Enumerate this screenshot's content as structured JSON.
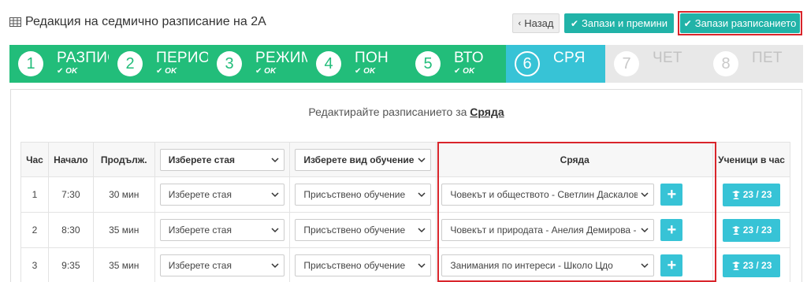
{
  "header": {
    "title": "Редакция на седмично разписание на 2А",
    "back_label": "Назад",
    "save_next_label": "Запази и премини",
    "save_label": "Запази разписанието"
  },
  "wizard": {
    "steps": [
      {
        "number": "1",
        "label": "РАЗПИС",
        "status": "OK",
        "state": "done"
      },
      {
        "number": "2",
        "label": "ПЕРИО,",
        "status": "OK",
        "state": "done"
      },
      {
        "number": "3",
        "label": "РЕЖИМ",
        "status": "OK",
        "state": "done"
      },
      {
        "number": "4",
        "label": "ПОН",
        "status": "OK",
        "state": "done"
      },
      {
        "number": "5",
        "label": "ВТО",
        "status": "OK",
        "state": "done"
      },
      {
        "number": "6",
        "label": "СРЯ",
        "status": "",
        "state": "active"
      },
      {
        "number": "7",
        "label": "ЧЕТ",
        "status": "",
        "state": "todo"
      },
      {
        "number": "8",
        "label": "ПЕТ",
        "status": "",
        "state": "todo"
      }
    ]
  },
  "main": {
    "subtitle_prefix": "Редактирайте разписанието за",
    "subtitle_day": "Сряда"
  },
  "table": {
    "headers": {
      "hour": "Час",
      "start": "Начало",
      "duration": "Продълж.",
      "room_select": "Изберете стая",
      "type_select": "Изберете вид обучение",
      "day": "Сряда",
      "students": "Ученици в час"
    },
    "rows": [
      {
        "hour": "1",
        "start": "7:30",
        "duration": "30 мин",
        "room": "Изберете стая",
        "type": "Присъствено обучение",
        "subject": "Човекът и обществото - Светлин Даскалов",
        "students": "23 / 23"
      },
      {
        "hour": "2",
        "start": "8:30",
        "duration": "35 мин",
        "room": "Изберете стая",
        "type": "Присъствено обучение",
        "subject": "Човекът и природата - Анелия Демирова - Фа",
        "students": "23 / 23"
      },
      {
        "hour": "3",
        "start": "9:35",
        "duration": "35 мин",
        "room": "Изберете стая",
        "type": "Присъствено обучение",
        "subject": "Занимания по интереси - Школо Цдо",
        "students": "23 / 23"
      }
    ]
  },
  "colors": {
    "done": "#22bd7a",
    "active": "#37c3d6",
    "todo": "#e8e8e8",
    "accent": "#21b3a8",
    "highlight": "#d9252b"
  },
  "icons": {
    "title": "table-grid-icon",
    "back": "chevron-left-icon",
    "check": "check-icon",
    "select": "chevron-down-icon",
    "add": "plus-icon",
    "students": "graduate-icon"
  }
}
